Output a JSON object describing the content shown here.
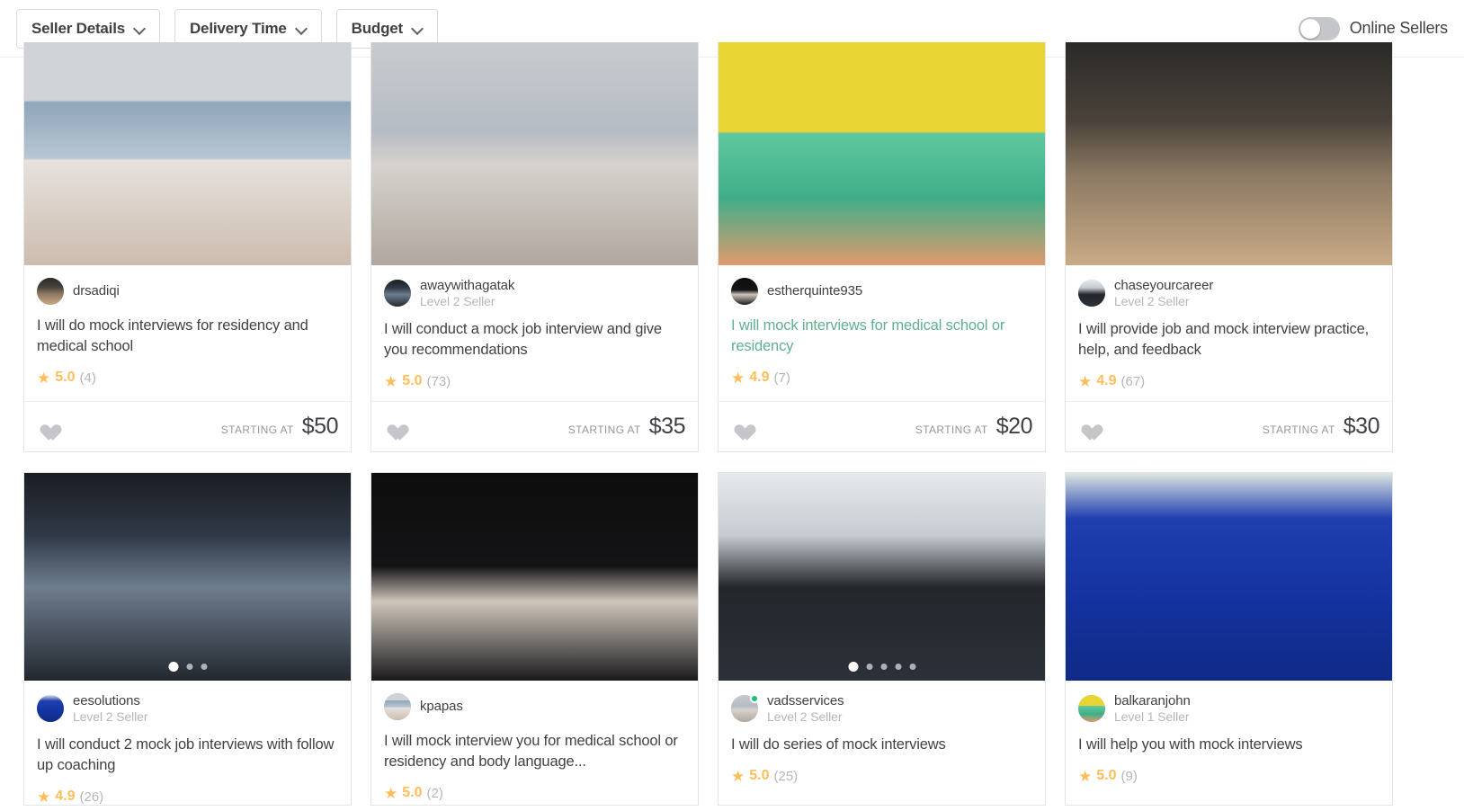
{
  "filters": {
    "items": [
      {
        "label": "Seller Details",
        "icon": "chevron-down-icon"
      },
      {
        "label": "Delivery Time",
        "icon": "chevron-down-icon"
      },
      {
        "label": "Budget",
        "icon": "chevron-down-icon"
      }
    ],
    "online_toggle": {
      "label": "Online Sellers",
      "state": "off"
    }
  },
  "labels": {
    "starting_at": "STARTING AT"
  },
  "colors": {
    "star": "#ffbe5b",
    "visited_link": "#5fb08d",
    "online_dot": "#1dbf73",
    "text": "#404145",
    "muted": "#b5b6ba"
  },
  "gigs": [
    {
      "username": "drsadiqi",
      "level": "",
      "online": false,
      "title": "I will do mock interviews for residency and medical school",
      "visited": false,
      "rating": "5.0",
      "reviews": "(4)",
      "price": "$50",
      "dots": 0,
      "active_dot": 0
    },
    {
      "username": "awaywithagatak",
      "level": "Level 2 Seller",
      "online": false,
      "title": "I will conduct a mock job interview and give you recommendations",
      "visited": false,
      "rating": "5.0",
      "reviews": "(73)",
      "price": "$35",
      "dots": 0,
      "active_dot": 0
    },
    {
      "username": "estherquinte935",
      "level": "",
      "online": false,
      "title": "I will mock interviews for medical school or residency",
      "visited": true,
      "rating": "4.9",
      "reviews": "(7)",
      "price": "$20",
      "dots": 0,
      "active_dot": 0
    },
    {
      "username": "chaseyourcareer",
      "level": "Level 2 Seller",
      "online": false,
      "title": "I will provide job and mock interview practice, help, and feedback",
      "visited": false,
      "rating": "4.9",
      "reviews": "(67)",
      "price": "$30",
      "dots": 0,
      "active_dot": 0
    },
    {
      "username": "eesolutions",
      "level": "Level 2 Seller",
      "online": false,
      "title": "I will conduct 2 mock job interviews with follow up coaching",
      "visited": false,
      "rating": "4.9",
      "reviews": "(26)",
      "price": "",
      "dots": 3,
      "active_dot": 0
    },
    {
      "username": "kpapas",
      "level": "",
      "online": false,
      "title": "I will mock interview you for medical school or residency and body language...",
      "visited": false,
      "rating": "5.0",
      "reviews": "(2)",
      "price": "",
      "dots": 0,
      "active_dot": 0
    },
    {
      "username": "vadsservices",
      "level": "Level 2 Seller",
      "online": true,
      "title": "I will do series of mock interviews",
      "visited": false,
      "rating": "5.0",
      "reviews": "(25)",
      "price": "",
      "dots": 5,
      "active_dot": 0
    },
    {
      "username": "balkaranjohn",
      "level": "Level 1 Seller",
      "online": false,
      "title": "I will help you with mock interviews",
      "visited": false,
      "rating": "5.0",
      "reviews": "(9)",
      "price": "",
      "dots": 0,
      "active_dot": 0
    }
  ]
}
